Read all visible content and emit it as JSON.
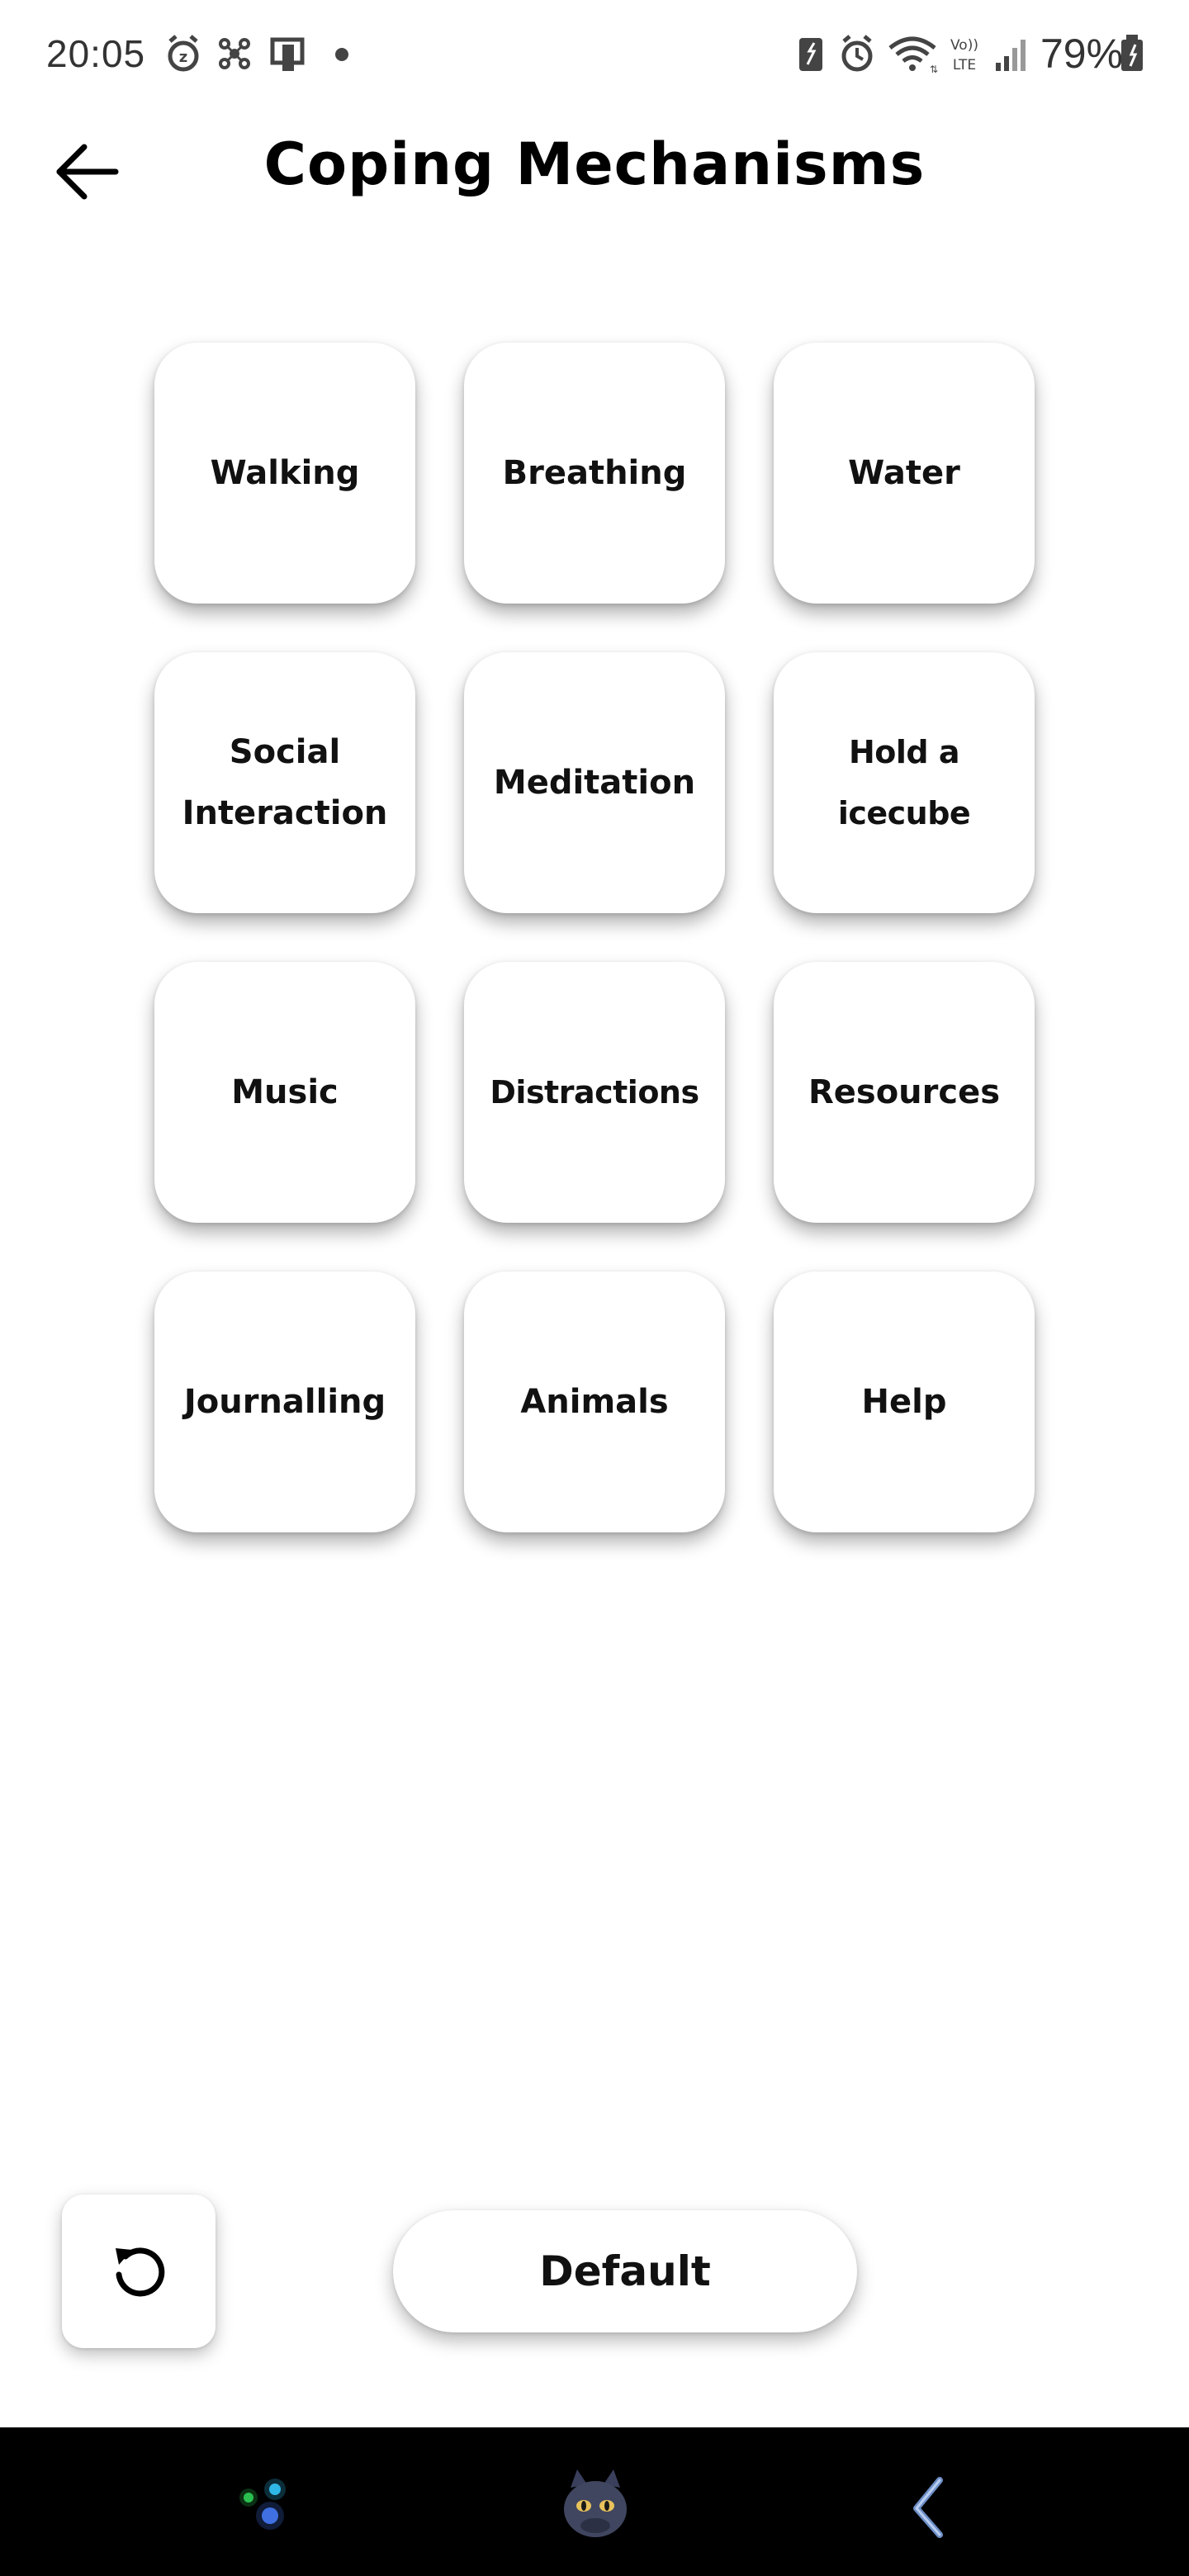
{
  "status_bar": {
    "time": "20:05",
    "battery_percent": "79%",
    "icons": [
      "alarm-snooze-icon",
      "network-icon",
      "device-icon",
      "notification-dot-icon",
      "battery-saver-icon",
      "alarm-icon",
      "wifi-icon",
      "volte-icon",
      "signal-icon",
      "battery-icon"
    ]
  },
  "header": {
    "title": "Coping Mechanisms",
    "back_icon": "arrow-left-icon"
  },
  "tiles": [
    {
      "label": "Walking"
    },
    {
      "label": "Breathing"
    },
    {
      "label": "Water"
    },
    {
      "label": "Social\nInteraction"
    },
    {
      "label": "Meditation"
    },
    {
      "label": "Hold a icecube"
    },
    {
      "label": "Music"
    },
    {
      "label": "Distractions"
    },
    {
      "label": "Resources"
    },
    {
      "label": "Journalling"
    },
    {
      "label": "Animals"
    },
    {
      "label": "Help"
    }
  ],
  "controls": {
    "reset_icon": "refresh-icon",
    "default_label": "Default"
  },
  "nav_bar": {
    "items": [
      "orbs-app-icon",
      "dragon-avatar-icon",
      "back-gesture-icon"
    ]
  },
  "colors": {
    "background": "#ffffff",
    "text": "#111111",
    "nav_bar": "#000000"
  }
}
